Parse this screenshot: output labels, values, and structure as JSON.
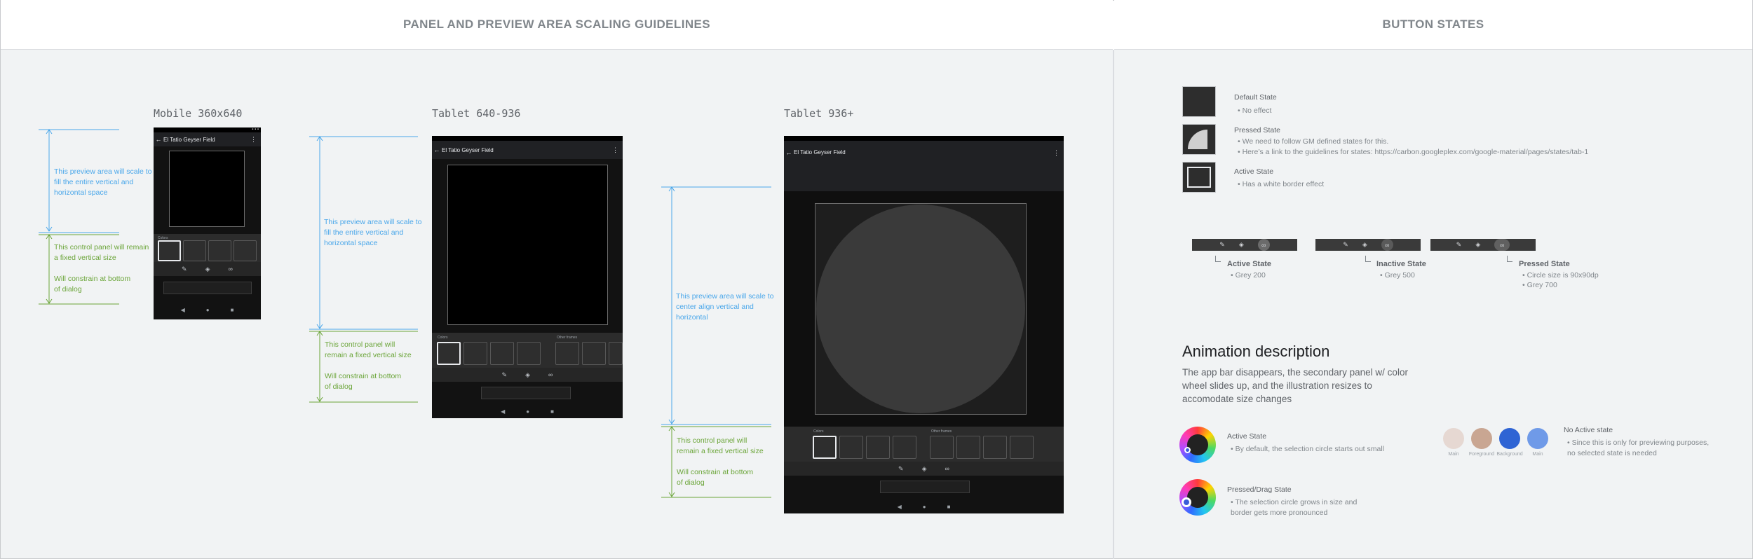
{
  "headers": {
    "left": "PANEL AND PREVIEW AREA SCALING GUIDELINES",
    "right": "BUTTON STATES"
  },
  "colors": {
    "blue_annotation": "#4aa7ea",
    "green_annotation": "#6ba539",
    "background": "#f1f3f4"
  },
  "devices": {
    "mobile": {
      "label": "Mobile 360x640",
      "app_title": "El Tatio Geyser Field",
      "section_label": "Colors"
    },
    "tablet": {
      "label": "Tablet 640-936",
      "app_title": "El Tatio Geyser Field",
      "section_label": "Colors",
      "section_label2": "Other frames"
    },
    "tablet_large": {
      "label": "Tablet 936+",
      "app_title": "El Tatio Geyser Field",
      "section_label": "Colors",
      "section_label2": "Other frames"
    }
  },
  "annotations": {
    "mobile_preview": "This preview area will scale to fill the entire vertical and horizontal space",
    "mobile_control": "This control panel will remain a fixed vertical size",
    "mobile_constrain": "Will constrain at bottom of dialog",
    "tablet_preview": "This preview area will scale to fill the entire vertical and horizontal space",
    "tablet_control": "This control panel will remain a fixed vertical size",
    "tablet_constrain": "Will constrain at bottom of dialog",
    "large_preview": "This preview area will scale to center align vertical and horizontal",
    "large_control": "This control panel will remain a fixed vertical size",
    "large_constrain": "Will constrain at bottom of dialog"
  },
  "states": {
    "default_title": "Default State",
    "default_desc": "No effect",
    "pressed_title": "Pressed State",
    "pressed_desc1": "We need to follow GM defined states for this.",
    "pressed_desc2": "Here’s a link to the guidelines for states: https://carbon.googleplex.com/google-material/pages/states/tab-1",
    "active_title": "Active State",
    "active_desc": "Has a white border effect"
  },
  "button_states": [
    {
      "title": "Active State",
      "desc": "Grey 200"
    },
    {
      "title": "Inactive State",
      "desc": "Grey 500"
    },
    {
      "title": "Pressed State",
      "desc": "Circle size is 90x90dp",
      "desc2": "Grey 700"
    }
  ],
  "animation": {
    "title": "Animation description",
    "description": "The app bar disappears, the secondary panel w/ color wheel slides up, and the illustration resizes to accomodate size changes",
    "active_title": "Active State",
    "active_desc": "By default, the selection circle  starts out small",
    "pressed_title": "Pressed/Drag State",
    "pressed_desc": "The selection circle grows in size and border gets more pronounced",
    "no_active_title": "No Active state",
    "no_active_desc": "Since this is only for previewing purposes, no selected state is needed"
  },
  "swatches": [
    {
      "label": "Main",
      "color": "#e6d8d2"
    },
    {
      "label": "Foreground",
      "color": "#c9a692"
    },
    {
      "label": "Background",
      "color": "#2f64d4"
    },
    {
      "label": "Main",
      "color": "#6f9ae8"
    }
  ]
}
